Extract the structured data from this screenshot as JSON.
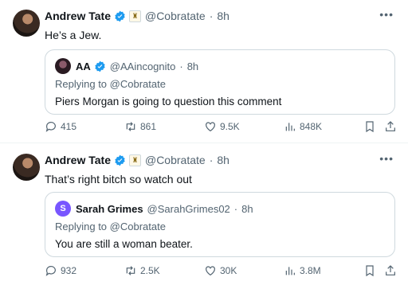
{
  "tweets": [
    {
      "author": {
        "name": "Andrew Tate",
        "handle": "@Cobratate",
        "time": "8h",
        "verified": true
      },
      "text": "He’s a Jew.",
      "quote": {
        "avatar_letter": "",
        "name": "AA",
        "handle": "@AAincognito",
        "time": "8h",
        "reply_to": "Replying to @Cobratate",
        "text": "Piers Morgan is going to question this comment"
      },
      "stats": {
        "replies": "415",
        "retweets": "861",
        "likes": "9.5K",
        "views": "848K"
      }
    },
    {
      "author": {
        "name": "Andrew Tate",
        "handle": "@Cobratate",
        "time": "8h",
        "verified": true
      },
      "text": "That’s right bitch so watch out",
      "quote": {
        "avatar_letter": "S",
        "name": "Sarah Grimes",
        "handle": "@SarahGrimes02",
        "time": "8h",
        "reply_to": "Replying to @Cobratate",
        "text": "You are still a woman beater."
      },
      "stats": {
        "replies": "932",
        "retweets": "2.5K",
        "likes": "30K",
        "views": "3.8M"
      }
    }
  ],
  "icons": {
    "more": "more-icon",
    "verified": "verified-badge-icon",
    "affiliate": "affiliate-badge-icon",
    "reply": "reply-icon",
    "retweet": "retweet-icon",
    "like": "heart-icon",
    "views": "views-icon",
    "bookmark": "bookmark-icon",
    "share": "share-icon"
  },
  "colors": {
    "verified": "#1d9bf0",
    "muted": "#536471",
    "border": "#cfd9de",
    "sg_avatar": "#7856ff"
  }
}
